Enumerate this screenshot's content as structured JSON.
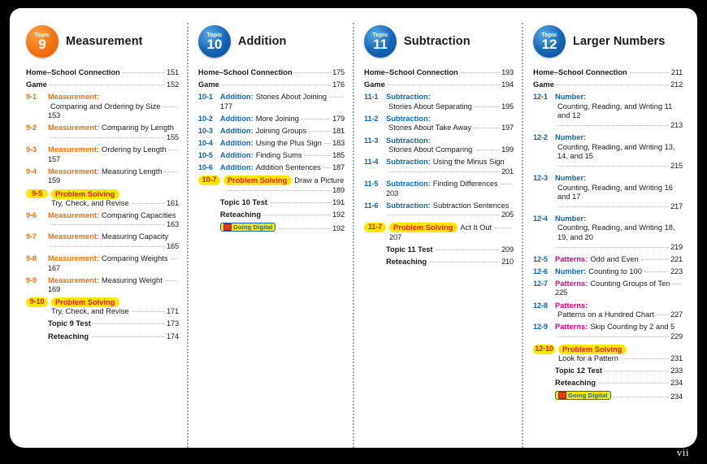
{
  "folio": "vii",
  "colors": {
    "orange": "#F4720F",
    "blue": "#1464B4",
    "pink": "#E5007D",
    "highlight": "#FFE800",
    "problem_solving_text": "#E8200E",
    "page_background": "#FFFFFF",
    "outer_background": "#000000"
  },
  "badge_word": "Topic",
  "going_digital_label": "Going Digital",
  "columns": [
    {
      "badge_number": "9",
      "badge_color": "orange",
      "title": "Measurement",
      "accent": "orange",
      "rows": [
        {
          "kind": "top",
          "num": "",
          "label": "",
          "text": "Home–School Connection",
          "page": "151"
        },
        {
          "kind": "top",
          "num": "",
          "label": "",
          "text": "Game",
          "page": "152"
        },
        {
          "kind": "lesson",
          "num": "9-1",
          "label": "Measurement:",
          "text": "Comparing and Ordering by Size",
          "page": "153"
        },
        {
          "kind": "lesson",
          "num": "9-2",
          "label": "Measurement:",
          "text": "Comparing by Length",
          "page": "155"
        },
        {
          "kind": "lesson",
          "num": "9-3",
          "label": "Measurement:",
          "text": "Ordering by Length",
          "page": "157"
        },
        {
          "kind": "lesson",
          "num": "9-4",
          "label": "Measurement:",
          "text": "Measuring Length",
          "page": "159"
        },
        {
          "kind": "problem",
          "num": "9-5",
          "label": "Problem Solving",
          "text": "Try, Check, and Revise",
          "page": "161"
        },
        {
          "kind": "lesson",
          "num": "9-6",
          "label": "Measurement:",
          "text": "Comparing Capacities",
          "page": "163"
        },
        {
          "kind": "lesson",
          "num": "9-7",
          "label": "Measurement:",
          "text": "Measuring Capacity",
          "page": "165"
        },
        {
          "kind": "lesson",
          "num": "9-8",
          "label": "Measurement:",
          "text": "Comparing Weights",
          "page": "167"
        },
        {
          "kind": "lesson",
          "num": "9-9",
          "label": "Measurement:",
          "text": "Measuring Weight",
          "page": "169"
        },
        {
          "kind": "problem",
          "num": "9-10",
          "label": "Problem Solving",
          "text": "Try, Check, and Revise",
          "page": "171"
        },
        {
          "kind": "sub",
          "num": "",
          "label": "",
          "text": "Topic 9 Test",
          "page": "173"
        },
        {
          "kind": "sub",
          "num": "",
          "label": "",
          "text": "Reteaching",
          "page": "174"
        }
      ]
    },
    {
      "badge_number": "10",
      "badge_color": "blue",
      "title": "Addition",
      "accent": "blue",
      "rows": [
        {
          "kind": "top",
          "num": "",
          "label": "",
          "text": "Home–School Connection",
          "page": "175"
        },
        {
          "kind": "top",
          "num": "",
          "label": "",
          "text": "Game",
          "page": "176"
        },
        {
          "kind": "lesson",
          "num": "10-1",
          "label": "Addition:",
          "text": "Stories About Joining",
          "page": "177"
        },
        {
          "kind": "lesson",
          "num": "10-2",
          "label": "Addition:",
          "text": "More Joining",
          "page": "179"
        },
        {
          "kind": "lesson",
          "num": "10-3",
          "label": "Addition:",
          "text": "Joining Groups",
          "page": "181"
        },
        {
          "kind": "lesson",
          "num": "10-4",
          "label": "Addition:",
          "text": "Using the Plus Sign",
          "page": "183"
        },
        {
          "kind": "lesson",
          "num": "10-5",
          "label": "Addition:",
          "text": "Finding Sums",
          "page": "185"
        },
        {
          "kind": "lesson",
          "num": "10-6",
          "label": "Addition:",
          "text": "Addition Sentences",
          "page": "187"
        },
        {
          "kind": "problem",
          "num": "10-7",
          "label": "Problem Solving",
          "text": "Draw a Picture",
          "page": "189"
        },
        {
          "kind": "sub",
          "num": "",
          "label": "",
          "text": "Topic 10 Test",
          "page": "191"
        },
        {
          "kind": "sub",
          "num": "",
          "label": "",
          "text": "Reteaching",
          "page": "192"
        },
        {
          "kind": "digital",
          "num": "",
          "label": "",
          "text": "Going Digital",
          "page": "192"
        }
      ]
    },
    {
      "badge_number": "11",
      "badge_color": "blue",
      "title": "Subtraction",
      "accent": "blue",
      "rows": [
        {
          "kind": "top",
          "num": "",
          "label": "",
          "text": "Home–School Connection",
          "page": "193"
        },
        {
          "kind": "top",
          "num": "",
          "label": "",
          "text": "Game",
          "page": "194"
        },
        {
          "kind": "lesson",
          "num": "11-1",
          "label": "Subtraction:",
          "text": "Stories About Separating",
          "page": "195"
        },
        {
          "kind": "lesson",
          "num": "11-2",
          "label": "Subtraction:",
          "text": "Stories About Take Away",
          "page": "197"
        },
        {
          "kind": "lesson",
          "num": "11-3",
          "label": "Subtraction:",
          "text": "Stories About Comparing",
          "page": "199"
        },
        {
          "kind": "lesson",
          "num": "11-4",
          "label": "Subtraction:",
          "text": "Using the Minus Sign",
          "page": "201"
        },
        {
          "kind": "lesson",
          "num": "11-5",
          "label": "Subtraction:",
          "text": "Finding Differences",
          "page": "203"
        },
        {
          "kind": "lesson",
          "num": "11-6",
          "label": "Subtraction:",
          "text": "Subtraction Sentences",
          "page": "205"
        },
        {
          "kind": "problem",
          "num": "11-7",
          "label": "Problem Solving",
          "text": "Act It Out",
          "page": "207"
        },
        {
          "kind": "sub",
          "num": "",
          "label": "",
          "text": "Topic 11 Test",
          "page": "209"
        },
        {
          "kind": "sub",
          "num": "",
          "label": "",
          "text": "Reteaching",
          "page": "210"
        }
      ]
    },
    {
      "badge_number": "12",
      "badge_color": "blue",
      "title": "Larger Numbers",
      "accent": "blue",
      "rows": [
        {
          "kind": "top",
          "num": "",
          "label": "",
          "text": "Home–School Connection",
          "page": "211"
        },
        {
          "kind": "top",
          "num": "",
          "label": "",
          "text": "Game",
          "page": "212"
        },
        {
          "kind": "lesson",
          "num": "12-1",
          "label": "Number:",
          "text": "Counting, Reading, and Writing 11 and 12",
          "page": "213"
        },
        {
          "kind": "lesson",
          "num": "12-2",
          "label": "Number:",
          "text": "Counting, Reading, and Writing 13, 14, and 15",
          "page": "215"
        },
        {
          "kind": "lesson",
          "num": "12-3",
          "label": "Number:",
          "text": "Counting, Reading, and Writing 16 and 17",
          "page": "217"
        },
        {
          "kind": "lesson",
          "num": "12-4",
          "label": "Number:",
          "text": "Counting, Reading, and Writing 18, 19, and 20",
          "page": "219"
        },
        {
          "kind": "lesson",
          "num": "12-5",
          "label": "Patterns:",
          "label_color": "pink",
          "text": "Odd and Even",
          "page": "221"
        },
        {
          "kind": "lesson",
          "num": "12-6",
          "label": "Number:",
          "text": "Counting to 100",
          "page": "223"
        },
        {
          "kind": "lesson",
          "num": "12-7",
          "label": "Patterns:",
          "label_color": "pink",
          "text": "Counting Groups of Ten",
          "page": "225"
        },
        {
          "kind": "lesson",
          "num": "12-8",
          "label": "Patterns:",
          "label_color": "pink",
          "text": "Patterns on a Hundred Chart",
          "page": "227"
        },
        {
          "kind": "lesson",
          "num": "12-9",
          "label": "Patterns:",
          "label_color": "pink",
          "text": "Skip Counting by 2 and 5",
          "page": "229"
        },
        {
          "kind": "problem",
          "num": "12-10",
          "label": "Problem Solving",
          "text": "Look for a Pattern",
          "page": "231"
        },
        {
          "kind": "sub",
          "num": "",
          "label": "",
          "text": "Topic 12 Test",
          "page": "233"
        },
        {
          "kind": "sub",
          "num": "",
          "label": "",
          "text": "Reteaching",
          "page": "234"
        },
        {
          "kind": "digital",
          "num": "",
          "label": "",
          "text": "Going Digital",
          "page": "234"
        }
      ]
    }
  ]
}
